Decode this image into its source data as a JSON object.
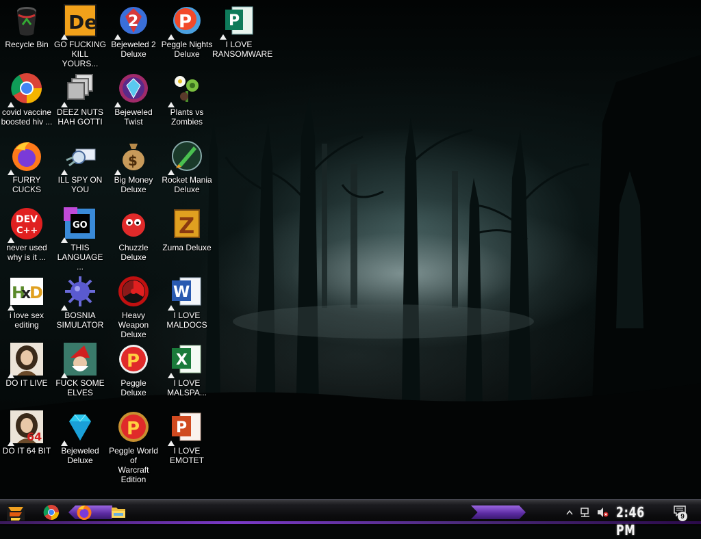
{
  "desktop": {
    "icons": [
      {
        "label": "Recycle Bin",
        "icon": "recycle-bin-icon"
      },
      {
        "label": "GO FUCKING\nKILL YOURS...",
        "icon": "de-app-icon"
      },
      {
        "label": "Bejeweled 2\nDeluxe",
        "icon": "bejeweled-2-icon"
      },
      {
        "label": "Peggle Nights\nDeluxe",
        "icon": "peggle-nights-icon"
      },
      {
        "label": "I LOVE\nRANSOMWARE",
        "icon": "publisher-icon"
      },
      {
        "label": "covid vaccine\nboosted hiv ...",
        "icon": "chrome-icon"
      },
      {
        "label": "DEEZ NUTS\nHAH GOTTI",
        "icon": "stacked-windows-icon"
      },
      {
        "label": "Bejeweled\nTwist",
        "icon": "bejeweled-twist-icon"
      },
      {
        "label": "Plants vs\nZombies",
        "icon": "plants-vs-zombies-icon"
      },
      {
        "label": "FURRY CUCKS",
        "icon": "firefox-icon"
      },
      {
        "label": "ILL SPY ON\nYOU",
        "icon": "spy-icon"
      },
      {
        "label": "Big Money\nDeluxe",
        "icon": "money-bag-icon"
      },
      {
        "label": "Rocket Mania\nDeluxe",
        "icon": "rocket-mania-icon"
      },
      {
        "label": "never used\nwhy is it ...",
        "icon": "devcpp-icon"
      },
      {
        "label": "THIS\nLANGUAGE ...",
        "icon": "goland-icon"
      },
      {
        "label": "Chuzzle Deluxe",
        "icon": "chuzzle-icon"
      },
      {
        "label": "Zuma Deluxe",
        "icon": "zuma-icon"
      },
      {
        "label": "i love sex\nediting",
        "icon": "hxd-icon"
      },
      {
        "label": "BOSNIA\nSIMULATOR",
        "icon": "spiked-ball-icon"
      },
      {
        "label": "Heavy Weapon\nDeluxe",
        "icon": "heavy-weapon-icon"
      },
      {
        "label": "I LOVE\nMALDOCS",
        "icon": "word-icon"
      },
      {
        "label": "DO IT LIVE",
        "icon": "portrait-icon"
      },
      {
        "label": "FUCK SOME\nELVES",
        "icon": "santa-icon"
      },
      {
        "label": "Peggle Deluxe",
        "icon": "peggle-icon"
      },
      {
        "label": "I LOVE\nMALSPA...",
        "icon": "excel-icon"
      },
      {
        "label": "DO IT 64 BIT",
        "icon": "portrait-64-icon"
      },
      {
        "label": "Bejeweled\nDeluxe",
        "icon": "diamond-icon"
      },
      {
        "label": "Peggle World of\nWarcraft Edition",
        "icon": "peggle-wow-icon"
      },
      {
        "label": "I LOVE EMOTET",
        "icon": "powerpoint-icon"
      }
    ]
  },
  "taskbar": {
    "clock": "2:46 PM",
    "notification_count": "9",
    "pinned": [
      "chrome-icon",
      "firefox-icon",
      "file-explorer-icon"
    ]
  }
}
